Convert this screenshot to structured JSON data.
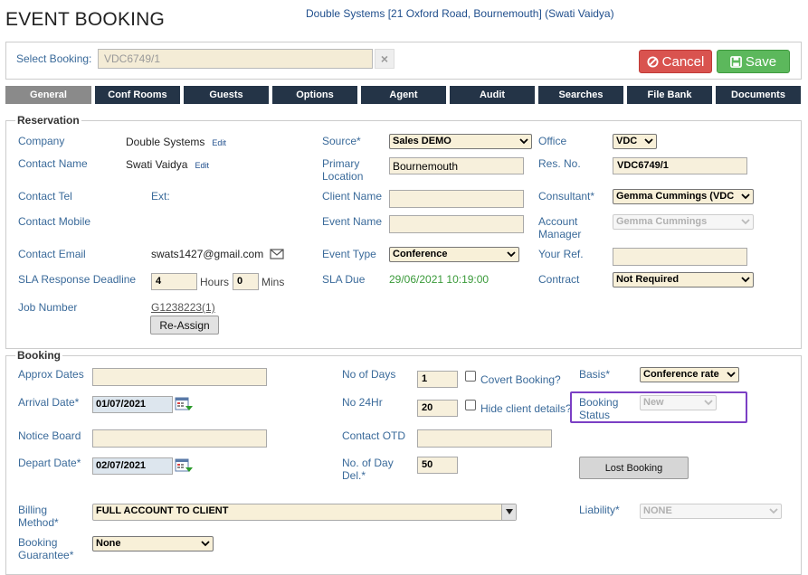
{
  "header": {
    "title": "EVENT BOOKING",
    "context": "Double Systems [21 Oxford Road, Bournemouth] (Swati Vaidya)"
  },
  "topbar": {
    "select_label": "Select Booking:",
    "select_value": "VDC6749/1",
    "clear_icon": "×",
    "cancel_label": "Cancel",
    "save_label": "Save"
  },
  "tabs": [
    {
      "label": "General"
    },
    {
      "label": "Conf Rooms"
    },
    {
      "label": "Guests"
    },
    {
      "label": "Options"
    },
    {
      "label": "Agent"
    },
    {
      "label": "Audit"
    },
    {
      "label": "Searches"
    },
    {
      "label": "File Bank"
    },
    {
      "label": "Documents"
    }
  ],
  "reservation": {
    "legend": "Reservation",
    "company_label": "Company",
    "company_value": "Double Systems",
    "company_edit": "Edit",
    "contact_name_label": "Contact Name",
    "contact_name_value": "Swati Vaidya",
    "contact_name_edit": "Edit",
    "contact_tel_label": "Contact Tel",
    "ext_label": "Ext:",
    "contact_mobile_label": "Contact Mobile",
    "contact_email_label": "Contact Email",
    "contact_email_value": "swats1427@gmail.com",
    "sla_label": "SLA Response Deadline",
    "sla_hours_value": "4",
    "hours_label": "Hours",
    "sla_mins_value": "0",
    "mins_label": "Mins",
    "job_label": "Job Number",
    "job_value": "G1238223(1)",
    "reassign_label": "Re-Assign",
    "source_label": "Source*",
    "source_value": "Sales DEMO",
    "primary_location_label_1": "Primary",
    "primary_location_label_2": "Location",
    "primary_location_value": "Bournemouth",
    "client_name_label": "Client Name",
    "event_name_label": "Event Name",
    "event_type_label": "Event Type",
    "event_type_value": "Conference",
    "sla_due_label": "SLA Due",
    "sla_due_value": "29/06/2021 10:19:00",
    "office_label": "Office",
    "office_value": "VDC",
    "res_no_label": "Res. No.",
    "res_no_value": "VDC6749/1",
    "consultant_label": "Consultant*",
    "consultant_value": "Gemma Cummings (VDC",
    "account_manager_label_1": "Account",
    "account_manager_label_2": "Manager",
    "account_manager_value": "Gemma Cummings",
    "your_ref_label": "Your Ref.",
    "contract_label": "Contract",
    "contract_value": "Not Required"
  },
  "booking": {
    "legend": "Booking",
    "approx_dates_label": "Approx Dates",
    "arrival_label": "Arrival Date*",
    "arrival_value": "01/07/2021",
    "notice_label": "Notice Board",
    "depart_label": "Depart Date*",
    "depart_value": "02/07/2021",
    "billing_label_1": "Billing",
    "billing_label_2": "Method*",
    "billing_value": "FULL ACCOUNT TO CLIENT",
    "guarantee_label_1": "Booking",
    "guarantee_label_2": "Guarantee*",
    "guarantee_value": "None",
    "no_days_label": "No of Days",
    "no_days_value": "1",
    "covert_label": "Covert Booking?",
    "no24_label": "No 24Hr",
    "no24_value": "20",
    "hide_label": "Hide client details?",
    "contact_otd_label": "Contact OTD",
    "day_del_label_1": "No. of Day",
    "day_del_label_2": "Del.*",
    "day_del_value": "50",
    "basis_label": "Basis*",
    "basis_value": "Conference rate",
    "status_label_1": "Booking",
    "status_label_2": "Status",
    "status_value": "New",
    "lost_label": "Lost Booking",
    "liability_label": "Liability*",
    "liability_value": "NONE"
  },
  "colors": {
    "highlight": "#7b3fc4",
    "tab_bg": "#243447",
    "tab_active": "#8a8a8a",
    "cancel": "#d9534f",
    "save": "#5cb85c"
  }
}
